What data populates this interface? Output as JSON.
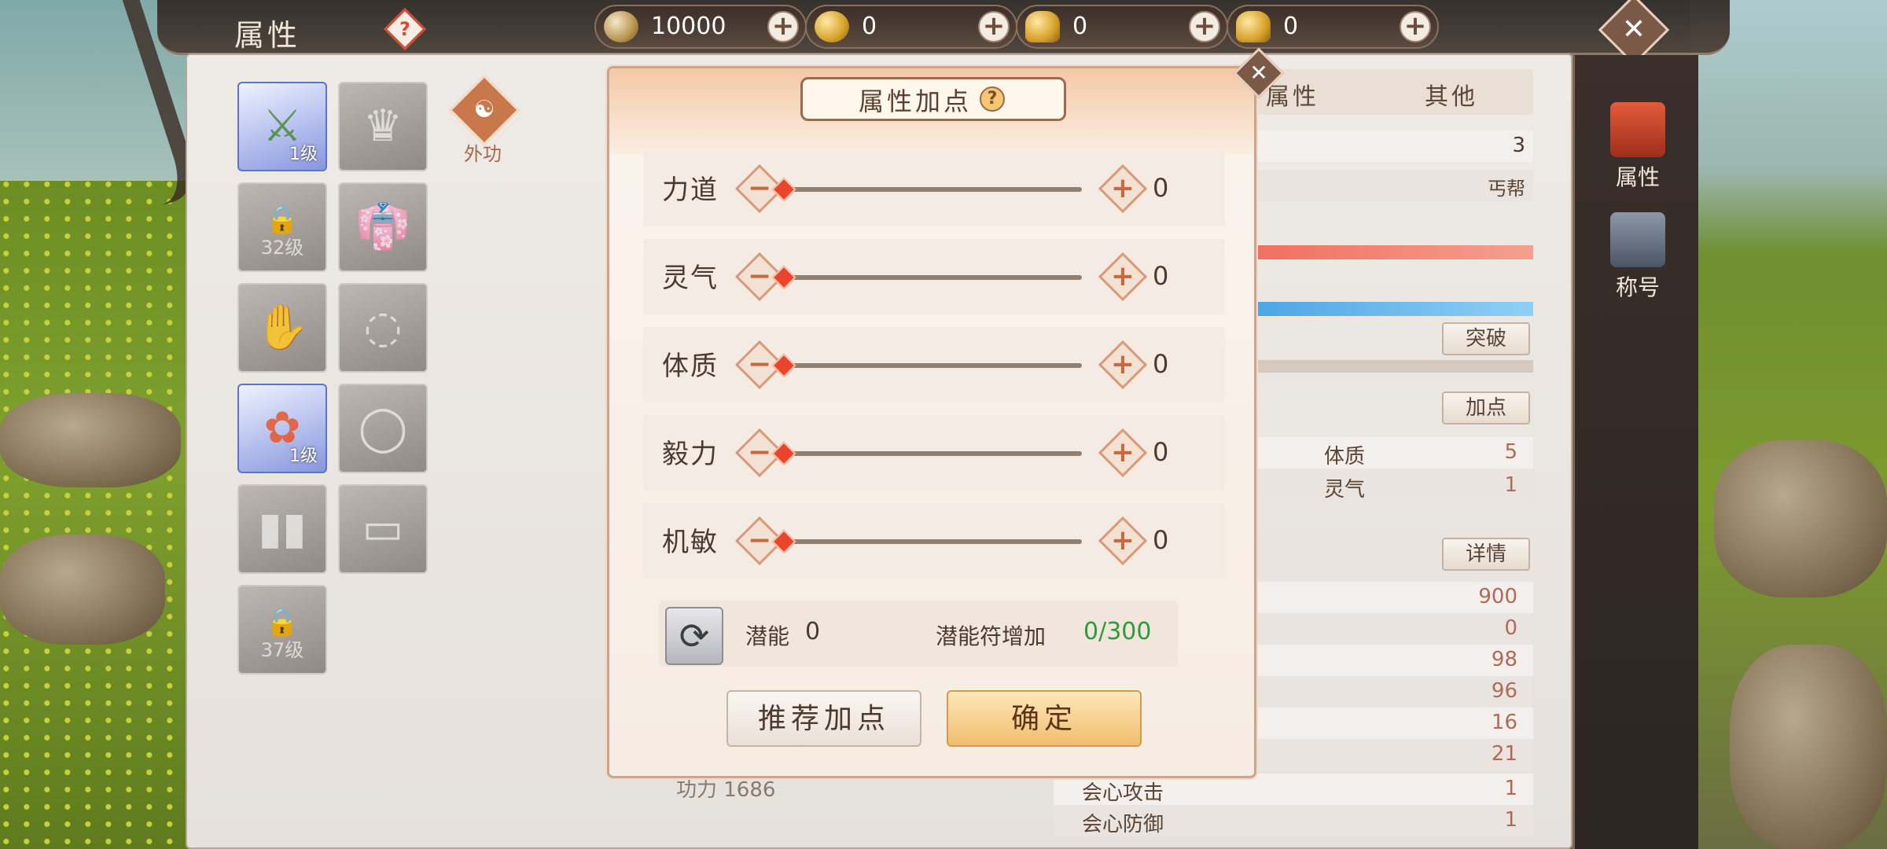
{
  "header": {
    "title": "属性",
    "help": "?"
  },
  "currencies": [
    {
      "icon": "coin-icon",
      "value": "10000"
    },
    {
      "icon": "gold-coin-icon",
      "value": "0"
    },
    {
      "icon": "bound-ingot-icon",
      "value": "0"
    },
    {
      "icon": "gold-ingot-icon",
      "value": "0"
    }
  ],
  "equip": {
    "slots": [
      {
        "name": "weapon",
        "level": "1级"
      },
      {
        "name": "helmet",
        "level": ""
      },
      {
        "locked": "32级"
      },
      {
        "name": "armor",
        "level": ""
      },
      {
        "name": "gloves",
        "level": ""
      },
      {
        "name": "necklace",
        "level": ""
      },
      {
        "name": "ring-main",
        "level": "1级"
      },
      {
        "name": "ring",
        "level": ""
      },
      {
        "name": "boots",
        "level": ""
      },
      {
        "name": "belt",
        "level": ""
      },
      {
        "locked": "37级"
      }
    ],
    "school_label": "外功"
  },
  "info_tabs": [
    "属性",
    "其他"
  ],
  "info": {
    "level": "3",
    "sect": "丐帮",
    "breakthrough": "突破",
    "addpoint": "加点",
    "stat1_label": "体质",
    "stat1_val": "5",
    "stat2_label": "灵气",
    "stat2_val": "1",
    "details": "详情",
    "values": [
      "900",
      "0",
      "98",
      "96",
      "16",
      "21",
      "1",
      "1"
    ],
    "crit_attack": "会心攻击",
    "crit_defense": "会心防御",
    "power": "功力 1686"
  },
  "side_tabs": [
    "属性",
    "称号"
  ],
  "dialog": {
    "title": "属性加点",
    "help": "?",
    "stats": [
      {
        "label": "力道",
        "value": "0"
      },
      {
        "label": "灵气",
        "value": "0"
      },
      {
        "label": "体质",
        "value": "0"
      },
      {
        "label": "毅力",
        "value": "0"
      },
      {
        "label": "机敏",
        "value": "0"
      }
    ],
    "potential_label": "潜能",
    "potential_value": "0",
    "talisman_label": "潜能符增加",
    "talisman_value": "0/300",
    "recommend": "推荐加点",
    "confirm": "确定"
  }
}
